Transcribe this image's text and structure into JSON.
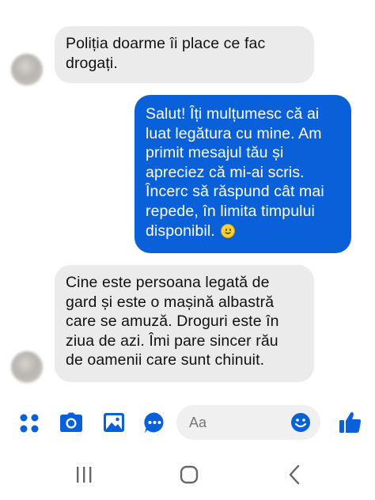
{
  "messages": [
    {
      "direction": "incoming",
      "lines": [
        "Poliția doarme îi place ce fac",
        "drogați."
      ]
    },
    {
      "direction": "outgoing",
      "lines": [
        "Salut! Îți mulțumesc că ai",
        "luat legătura cu mine. Am",
        "primit mesajul tău și",
        "apreciez că mi-ai scris.",
        "Încerc să răspund cât mai",
        "repede, în limita timpului",
        "disponibil."
      ],
      "trailing_emoji": "smiling-face-emoji"
    },
    {
      "direction": "incoming",
      "lines": [
        "Cine este persoana legată de",
        "gard și este o mașină albastră",
        "care se amuză. Droguri este în",
        "ziua de azi. Îmi pare sincer rău",
        "de oamenii care sunt chinuit."
      ]
    }
  ],
  "composer": {
    "placeholder": "Aa",
    "icons": [
      "grid-menu-icon",
      "camera-icon",
      "gallery-icon",
      "voice-message-icon",
      "emoji-icon",
      "thumbs-up-icon"
    ]
  },
  "navbar": {
    "icons": [
      "recent-apps-icon",
      "home-icon",
      "back-icon"
    ]
  },
  "colors": {
    "accent": "#0a60d9",
    "incoming_bubble": "#ebebeb",
    "background": "#ffffff",
    "navbar_icon": "#666666"
  }
}
